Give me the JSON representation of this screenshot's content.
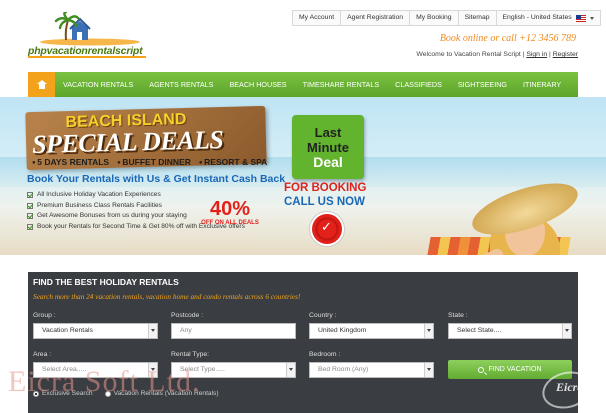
{
  "header": {
    "logo_text": "phpvacationrentalscript",
    "topnav": [
      "My Account",
      "Agent Registration",
      "My Booking",
      "Sitemap"
    ],
    "language": "English - United States",
    "callout": "Book online or call +12 3456 789",
    "welcome_text": "Welcome to Vacation Rental Script |",
    "sign_in": "Sign in",
    "separator": "|",
    "register": "Register"
  },
  "mainnav": {
    "items": [
      "VACATION RENTALS",
      "AGENTS RENTALS",
      "BEACH HOUSES",
      "TIMESHARE RENTALS",
      "CLASSIFIEDS",
      "SIGHTSEEING",
      "ITINERARY"
    ],
    "accent_color": "#f2a31b",
    "bar_color": "#6bb536"
  },
  "slider": {
    "sign_title": "BEACH ISLAND",
    "sign_special": "SPECIAL DEALS",
    "features": [
      "5 DAYS RENTALS",
      "BUFFET DINNER",
      "RESORT & SPA"
    ],
    "book_title": "Book Your Rentals with Us & Get Instant Cash Back",
    "checklist": [
      "All Inclusive Holiday Vacation Experiences",
      "Premium Business Class Rentals Facilities",
      "Get Awesome Bonuses from us during your staying",
      "Book your Rentals for Second Time & Get 80% off with Exclusive offers"
    ],
    "percent": "40%",
    "percent_sub": "OFF ON ALL DEALS",
    "lm_line1": "Last",
    "lm_line2": "Minute",
    "lm_line3": "Deal",
    "for_booking": "FOR BOOKING",
    "call_us": "CALL US NOW",
    "prev_arrow": "‹",
    "next_arrow": "›"
  },
  "search": {
    "title": "FIND THE BEST HOLIDAY RENTALS",
    "subtitle": "Search more than 24 vacation rentals, vacation home and condo rentals across 6 countries!",
    "labels": {
      "group": "Group :",
      "postcode": "Postcode :",
      "country": "Country :",
      "state": "State :",
      "area": "Area :",
      "rental_type": "Rental Type:",
      "bedroom": "Bedroom :"
    },
    "group_value": "Vacation Rentals",
    "postcode_placeholder": "Any",
    "country_value": "United Kingdom",
    "state_value": "Select State....",
    "area_value": "Select Area.....",
    "rental_type_value": "Select Type.....",
    "bedroom_value": "Bed Room (Any)",
    "find_button": "FIND VACATION",
    "radio_1": "Exclusive Search",
    "radio_2": "Vacation Rentals (Vacation Rentals)"
  },
  "watermark": {
    "text": "Eicra Soft Ltd.",
    "logo_text": "Eicra"
  }
}
